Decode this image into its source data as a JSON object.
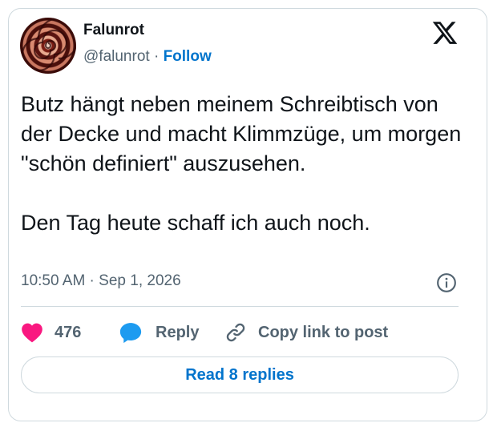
{
  "author": {
    "display_name": "Falunrot",
    "handle": "@falunrot",
    "separator": "·",
    "follow_label": "Follow"
  },
  "tweet": {
    "paragraphs": [
      "Butz hängt neben meinem Schreibtisch von der Decke und macht Klimmzüge, um morgen \"schön definiert\" auszusehen.",
      "Den Tag heute schaff ich auch noch."
    ],
    "timestamp": "10:50 AM · Sep 1, 2026"
  },
  "actions": {
    "like_count": "476",
    "reply_label": "Reply",
    "copy_label": "Copy link to post"
  },
  "read_replies_label": "Read 8 replies",
  "icons": {
    "logo": "x-logo-icon",
    "like": "heart-icon",
    "reply": "speech-bubble-icon",
    "copy": "link-icon",
    "info": "info-icon"
  },
  "colors": {
    "like": "#f91880",
    "reply": "#1d9bf0",
    "link_blue": "#0074cc",
    "secondary_text": "#536471",
    "border": "#cfd9de"
  }
}
